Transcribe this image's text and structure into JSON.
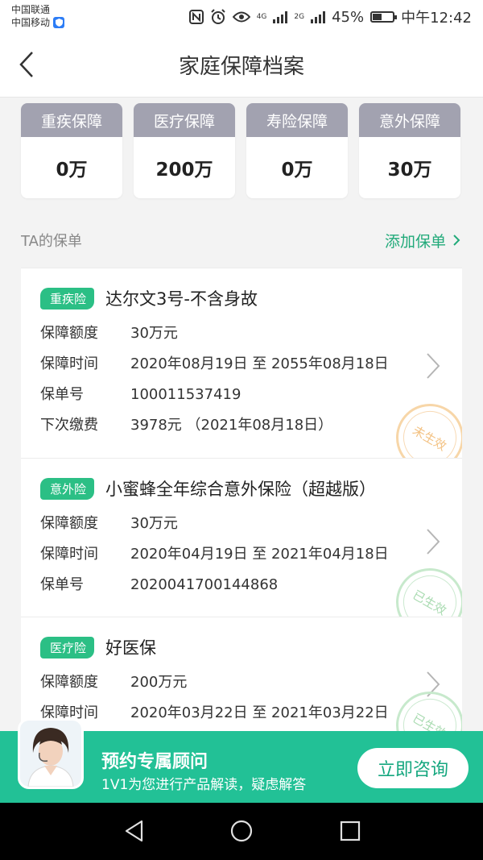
{
  "status_bar": {
    "carrier_1": "中国联通",
    "carrier_2": "中国移动",
    "net_4g": "4G",
    "net_2g": "2G",
    "battery": "45%",
    "time": "中午12:42"
  },
  "header": {
    "title": "家庭保障档案",
    "back_icon": "chevron-left-icon"
  },
  "summary": [
    {
      "label": "重疾保障",
      "value": "0万"
    },
    {
      "label": "医疗保障",
      "value": "200万"
    },
    {
      "label": "寿险保障",
      "value": "0万"
    },
    {
      "label": "意外保障",
      "value": "30万"
    }
  ],
  "policies_section": {
    "label": "TA的保单",
    "add_link": "添加保单",
    "field_labels": {
      "amount": "保障额度",
      "period": "保障时间",
      "policy_no": "保单号",
      "next_payment": "下次缴费"
    },
    "policies": [
      {
        "type": "重疾险",
        "name": "达尔文3号-不含身故",
        "amount": "30万元",
        "period": "2020年08月19日 至 2055年08月18日",
        "policy_no": "100011537419",
        "next_payment": "3978元 （2021年08月18日）",
        "status": "未生效",
        "status_color": "#f3c283"
      },
      {
        "type": "意外险",
        "name": "小蜜蜂全年综合意外保险（超越版）",
        "amount": "30万元",
        "period": "2020年04月19日 至 2021年04月18日",
        "policy_no": "2020041700144868",
        "status": "已生效",
        "status_color": "#a9dbb1"
      },
      {
        "type": "医疗险",
        "name": "好医保",
        "amount": "200万元",
        "period": "2020年03月22日 至 2021年03月22日",
        "status": "已生效",
        "status_color": "#a9dbb1"
      }
    ]
  },
  "consult_banner": {
    "title": "预约专属顾问",
    "subtitle": "1V1为您进行产品解读，疑虑解答",
    "button": "立即咨询"
  },
  "colors": {
    "accent": "#22c196",
    "card_header": "#a2a2b0",
    "link": "#22aa7a"
  }
}
